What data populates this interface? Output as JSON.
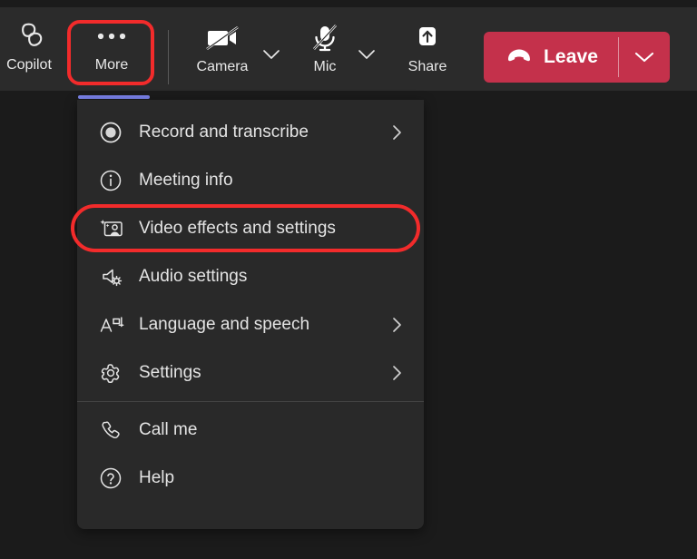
{
  "app": "Microsoft Teams meeting controls",
  "colors": {
    "page_background": "#1b1b1b",
    "toolbar_background": "#2b2b2b",
    "menu_background": "#292929",
    "leave_red": "#c4314b",
    "highlight_red": "#f22b2b",
    "active_underline_purple": "#7b83eb",
    "text": "#e8e8e8"
  },
  "toolbar": {
    "items": [
      {
        "label": "Copilot",
        "icon": "copilot-icon"
      },
      {
        "label": "More",
        "icon": "more-ellipsis-icon",
        "active": true,
        "highlighted": true
      },
      {
        "label": "Camera",
        "icon": "camera-off-icon",
        "muted": true
      },
      {
        "label": "Mic",
        "icon": "microphone-off-icon",
        "muted": true
      },
      {
        "label": "Share",
        "icon": "share-screen-icon"
      }
    ],
    "camera_chevron_icon": "chevron-down-icon",
    "mic_chevron_icon": "chevron-down-icon",
    "leave": {
      "label": "Leave",
      "icon": "hang-up-icon",
      "chevron_icon": "chevron-down-icon"
    }
  },
  "menu": {
    "groups": [
      {
        "items": [
          {
            "label": "Record and transcribe",
            "icon": "record-icon",
            "submenu": true
          },
          {
            "label": "Meeting info",
            "icon": "info-circle-icon",
            "submenu": false
          },
          {
            "label": "Video effects and settings",
            "icon": "video-effects-icon",
            "submenu": false,
            "highlighted": true
          },
          {
            "label": "Audio settings",
            "icon": "speaker-settings-icon",
            "submenu": false
          },
          {
            "label": "Language and speech",
            "icon": "language-icon",
            "submenu": true
          },
          {
            "label": "Settings",
            "icon": "gear-icon",
            "submenu": true
          }
        ]
      },
      {
        "items": [
          {
            "label": "Call me",
            "icon": "phone-icon",
            "submenu": false
          },
          {
            "label": "Help",
            "icon": "help-circle-icon",
            "submenu": false
          }
        ]
      }
    ]
  }
}
